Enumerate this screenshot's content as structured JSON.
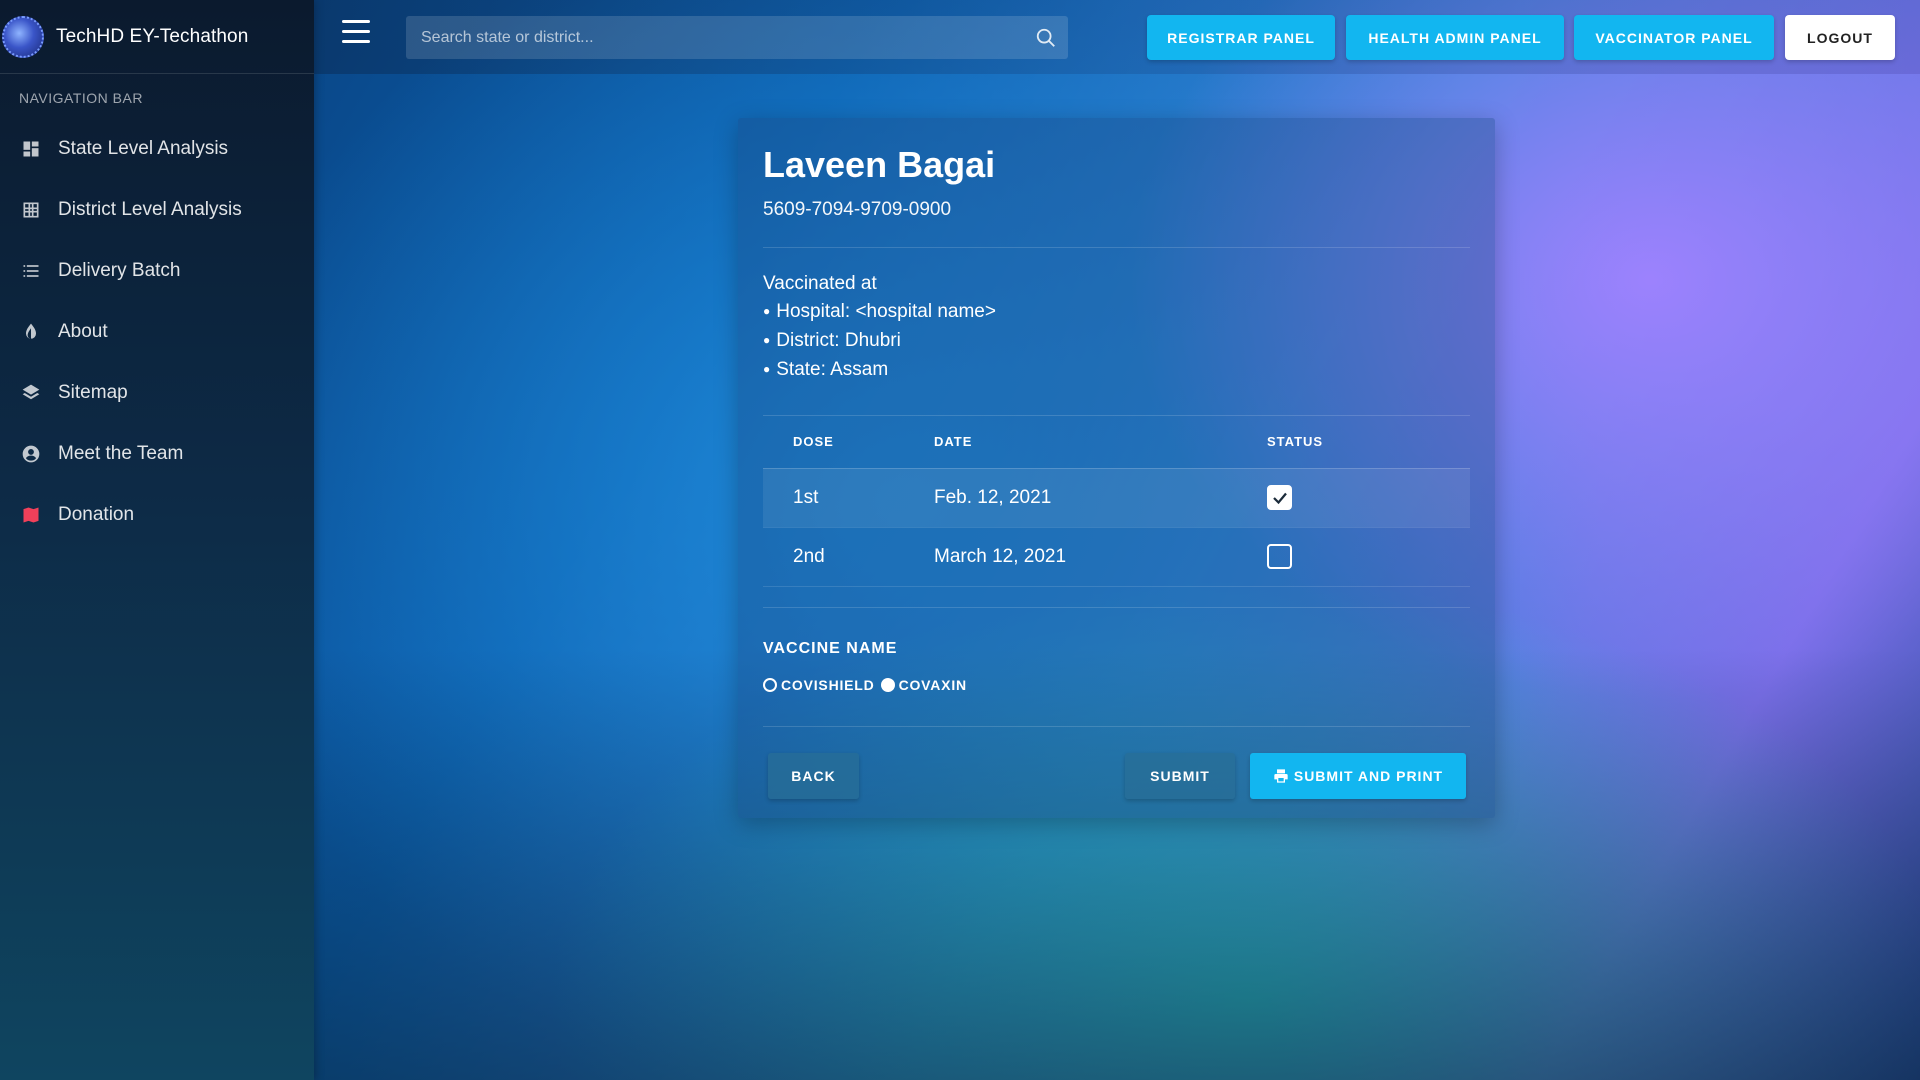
{
  "brand": {
    "title": "TechHD EY-Techathon"
  },
  "sidebar": {
    "heading": "NAVIGATION BAR",
    "items": [
      {
        "label": "State Level Analysis",
        "icon": "dashboard-icon"
      },
      {
        "label": "District Level Analysis",
        "icon": "grid-icon"
      },
      {
        "label": "Delivery Batch",
        "icon": "list-icon"
      },
      {
        "label": "About",
        "icon": "contrast-icon"
      },
      {
        "label": "Sitemap",
        "icon": "layers-icon"
      },
      {
        "label": "Meet the Team",
        "icon": "user-circle-icon"
      },
      {
        "label": "Donation",
        "icon": "map-icon"
      }
    ]
  },
  "topbar": {
    "search_placeholder": "Search state or district...",
    "buttons": {
      "registrar": "REGISTRAR PANEL",
      "health_admin": "HEALTH ADMIN PANEL",
      "vaccinator": "VACCINATOR PANEL",
      "logout": "LOGOUT"
    }
  },
  "patient": {
    "name": "Laveen Bagai",
    "id": "5609-7094-9709-0900",
    "vaccinated_heading": "Vaccinated at",
    "hospital": "Hospital: <hospital name>",
    "district": "District: Dhubri",
    "state": "State: Assam"
  },
  "doses": {
    "headers": {
      "dose": "DOSE",
      "date": "DATE",
      "status": "STATUS"
    },
    "rows": [
      {
        "dose": "1st",
        "date": "Feb. 12, 2021",
        "done": true
      },
      {
        "dose": "2nd",
        "date": "March 12, 2021",
        "done": false
      }
    ]
  },
  "vaccine": {
    "label": "VACCINE NAME",
    "options": [
      {
        "label": "COVISHIELD",
        "selected": false
      },
      {
        "label": "COVAXIN",
        "selected": true
      }
    ]
  },
  "actions": {
    "back": "BACK",
    "submit": "SUBMIT",
    "submit_print": "SUBMIT AND PRINT"
  },
  "colors": {
    "accent": "#12b6f0",
    "donation_icon": "#f0405a"
  }
}
